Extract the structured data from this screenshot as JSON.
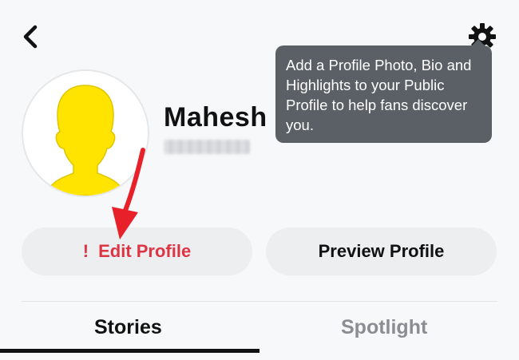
{
  "header": {
    "back_icon": "chevron-left-icon",
    "settings_icon": "gear-icon"
  },
  "profile": {
    "name": "Mahesh",
    "avatar_icon": "default-avatar-silhouette",
    "avatar_color": "#ffe400"
  },
  "tooltip": {
    "text": "Add a Profile Photo, Bio and Highlights to your Public Profile to help fans discover you."
  },
  "buttons": {
    "edit_profile": {
      "alert": "!",
      "label": "Edit Profile",
      "color": "#dd3544"
    },
    "preview_profile": {
      "label": "Preview Profile"
    }
  },
  "tabs": [
    {
      "label": "Stories",
      "active": true
    },
    {
      "label": "Spotlight",
      "active": false
    }
  ],
  "annotation": {
    "arrow_color": "#e8202a"
  }
}
